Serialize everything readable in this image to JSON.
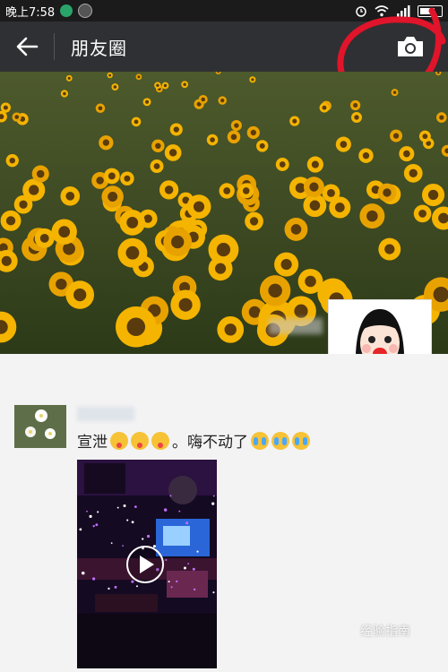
{
  "status": {
    "time": "晚上7:58"
  },
  "header": {
    "title": "朋友圈"
  },
  "post": {
    "text": "宣泄",
    "text_middle": "。嗨不动了",
    "emojis_first": [
      "tongue-out-emoji",
      "tongue-out-emoji",
      "tongue-out-emoji"
    ],
    "emojis_last": [
      "crying-emoji",
      "crying-emoji",
      "crying-emoji"
    ]
  },
  "watermark": {
    "text": "经验指南"
  },
  "colors": {
    "navbar": "#2f3033",
    "statusbar": "#1b1b1b",
    "annotation": "#e0142a"
  }
}
